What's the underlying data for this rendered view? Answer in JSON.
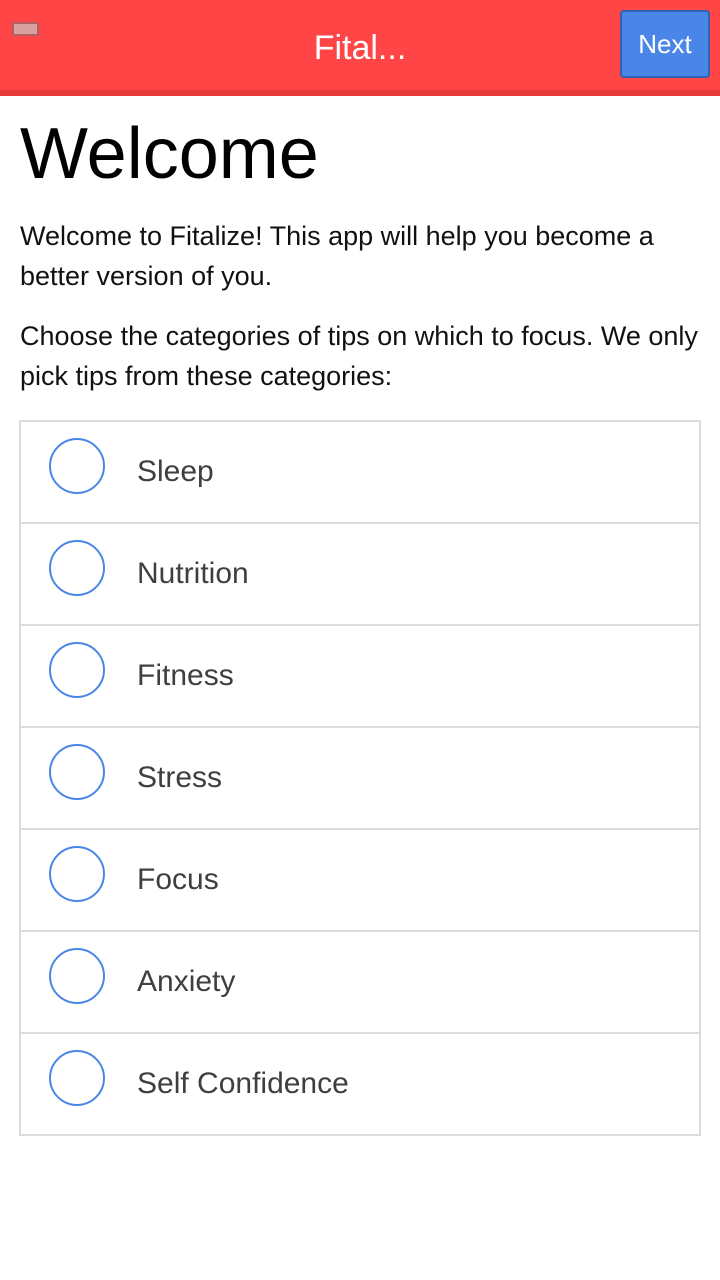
{
  "header": {
    "title": "Fital...",
    "next_label": "Next",
    "menu_icon": "menu-icon",
    "color": "#ff4546"
  },
  "main": {
    "title": "Welcome",
    "intro": "Welcome to Fitalize! This app will help you become a better version of you.",
    "instructions": "Choose the categories of tips on which to focus. We only pick tips from these categories:",
    "categories": [
      {
        "label": "Sleep",
        "selected": false
      },
      {
        "label": "Nutrition",
        "selected": false
      },
      {
        "label": "Fitness",
        "selected": false
      },
      {
        "label": "Stress",
        "selected": false
      },
      {
        "label": "Focus",
        "selected": false
      },
      {
        "label": "Anxiety",
        "selected": false
      },
      {
        "label": "Self Confidence",
        "selected": false
      }
    ]
  },
  "colors": {
    "accent": "#4a86e8",
    "header": "#ff4546"
  }
}
